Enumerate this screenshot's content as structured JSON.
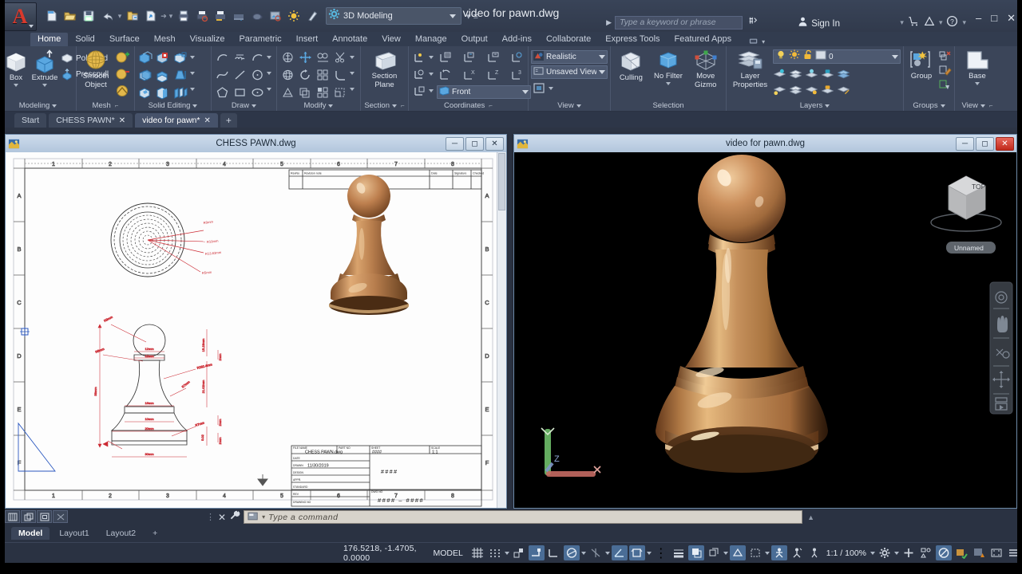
{
  "title_bar": {
    "app_logo": "autocad-a-logo",
    "document_title": "video for pawn.dwg",
    "workspace": "3D Modeling",
    "search_placeholder": "Type a keyword or phrase",
    "sign_in": "Sign In",
    "quick_access": [
      {
        "name": "new",
        "glyph": "new-file-icon"
      },
      {
        "name": "open",
        "glyph": "open-folder-icon"
      },
      {
        "name": "save",
        "glyph": "save-disk-icon"
      },
      {
        "name": "undo",
        "glyph": "undo-arrow-icon"
      },
      {
        "name": "redo",
        "glyph": "redo-arrow-icon"
      },
      {
        "name": "saveas",
        "glyph": "save-as-icon"
      },
      {
        "name": "export",
        "glyph": "export-icon"
      },
      {
        "name": "plot",
        "glyph": "plot-printer-icon"
      },
      {
        "name": "plotpreview",
        "glyph": "plot-preview-icon"
      },
      {
        "name": "batchplot",
        "glyph": "batch-plot-icon"
      },
      {
        "name": "render",
        "glyph": "render-teapot-icon"
      },
      {
        "name": "publish",
        "glyph": "publish-icon"
      },
      {
        "name": "sun",
        "glyph": "sun-properties-icon"
      },
      {
        "name": "properties",
        "glyph": "properties-icon"
      }
    ],
    "window_buttons": [
      "minimize",
      "maximize",
      "close"
    ]
  },
  "ribbon": {
    "tabs": [
      {
        "label": "Home",
        "active": true
      },
      {
        "label": "Solid",
        "active": false
      },
      {
        "label": "Surface",
        "active": false
      },
      {
        "label": "Mesh",
        "active": false
      },
      {
        "label": "Visualize",
        "active": false
      },
      {
        "label": "Parametric",
        "active": false
      },
      {
        "label": "Insert",
        "active": false
      },
      {
        "label": "Annotate",
        "active": false
      },
      {
        "label": "View",
        "active": false
      },
      {
        "label": "Manage",
        "active": false
      },
      {
        "label": "Output",
        "active": false
      },
      {
        "label": "Add-ins",
        "active": false
      },
      {
        "label": "Collaborate",
        "active": false
      },
      {
        "label": "Express Tools",
        "active": false
      },
      {
        "label": "Featured Apps",
        "active": false
      }
    ],
    "panels": [
      {
        "name": "Modeling",
        "big_buttons": [
          {
            "label": "Box",
            "icon": "box-solid-icon",
            "dropdown": true
          },
          {
            "label": "Extrude",
            "icon": "extrude-icon",
            "dropdown": true
          }
        ],
        "small_buttons": [
          {
            "label": "Polysolid",
            "icon": "polysolid-icon"
          },
          {
            "label": "Presspull",
            "icon": "presspull-icon"
          }
        ]
      },
      {
        "name": "Mesh",
        "big_buttons": [
          {
            "label_line1": "Smooth",
            "label_line2": "Object",
            "icon": "smooth-object-sphere-icon"
          }
        ],
        "icons": [
          "mesh-refine-icon",
          "mesh-smooth-less-icon",
          "mesh-crease-icon"
        ],
        "dialog_launcher": true
      },
      {
        "name": "Solid Editing",
        "icons": [
          "solid-union-icon",
          "solid-subtract-icon",
          "solid-3dmove-icon",
          "solid-intersect-icon",
          "solid-slice-icon",
          "solid-taper-face-icon",
          "solid-imprint-icon",
          "solid-shell-icon",
          "solid-separate-icon"
        ]
      },
      {
        "name": "Draw",
        "icons": [
          "arc-icon",
          "revcloud-icon",
          "arc3point-icon",
          "spline-icon",
          "line-icon",
          "circle-icon",
          "polygon-icon",
          "rectangle-icon",
          "ellipse-icon"
        ]
      },
      {
        "name": "Modify",
        "icons": [
          "3d-align-icon",
          "move-icon",
          "3d-mirror-icon",
          "trim-icon",
          "3d-rotate-icon",
          "rotate-icon",
          "3d-array-icon",
          "fillet-icon",
          "3d-scale-icon",
          "scale-icon",
          "offset-icon",
          "array-icon"
        ]
      },
      {
        "name": "Section",
        "big_buttons": [
          {
            "label_line1": "Section",
            "label_line2": "Plane",
            "icon": "section-plane-icon"
          }
        ],
        "dialog_launcher": true
      },
      {
        "name": "Coordinates",
        "icons": [
          "ucs-origin-icon",
          "ucs-named-icon",
          "ucs-face-icon",
          "ucs-view-icon",
          "ucs-object-icon",
          "ucs-world-icon",
          "ucs-previous-icon",
          "ucs-x-icon",
          "ucs-z-icon",
          "ucs-3point-icon",
          "ucs-display-icon"
        ],
        "combo": {
          "value": "Front",
          "icon": "ucs-front-icon"
        },
        "dialog_launcher": true
      },
      {
        "name": "View",
        "combos": [
          {
            "value": "Realistic",
            "icon": "visual-style-icon"
          },
          {
            "value": "Unsaved View",
            "icon": "named-view-icon"
          }
        ],
        "icons": [
          "viewport-config-icon"
        ]
      },
      {
        "name": "Selection",
        "big_buttons": [
          {
            "label": "Culling",
            "icon": "culling-cube-icon"
          },
          {
            "label": "No Filter",
            "icon": "no-filter-cube-icon",
            "dropdown": true
          },
          {
            "label_line1": "Move",
            "label_line2": "Gizmo",
            "icon": "move-gizmo-icon",
            "dropdown": true
          }
        ]
      },
      {
        "name": "Layers",
        "big_buttons": [
          {
            "label_line1": "Layer",
            "label_line2": "Properties",
            "icon": "layer-properties-icon"
          }
        ],
        "layer_combo": {
          "value": "0",
          "state_icons": [
            "layer-on-bulb-icon",
            "layer-thaw-sun-icon",
            "layer-unlock-icon",
            "layer-color-swatch"
          ]
        },
        "icons_row1": [
          "layer-isolate-icon",
          "layer-unisolate-icon",
          "layer-freeze-icon",
          "layer-lock-icon",
          "layer-make-current-icon"
        ],
        "icons_row2": [
          "layer-off-icon",
          "layer-turn-all-on-icon",
          "layer-thaw-all-icon",
          "layer-unlock-all-icon",
          "layer-match-icon"
        ]
      },
      {
        "name": "Groups",
        "big_buttons": [
          {
            "label": "Group",
            "icon": "group-icon"
          }
        ],
        "icons": [
          "ungroup-icon",
          "group-edit-icon",
          "group-selection-icon"
        ]
      },
      {
        "name": "View",
        "big_buttons": [
          {
            "label": "Base",
            "icon": "base-view-icon",
            "dropdown": true
          }
        ],
        "dialog_launcher": true
      }
    ]
  },
  "file_tabs": [
    {
      "label": "Start",
      "active": false,
      "closable": false
    },
    {
      "label": "CHESS PAWN*",
      "active": false,
      "closable": true
    },
    {
      "label": "video for pawn*",
      "active": true,
      "closable": true
    },
    {
      "label": "+",
      "active": false,
      "closable": false
    }
  ],
  "windows": {
    "left": {
      "title": "CHESS PAWN.dwg",
      "icon": "dwg-file-icon",
      "buttons": [
        "minimize",
        "restore",
        "close"
      ],
      "drawing": {
        "ruler_top": [
          "1",
          "2",
          "3",
          "4",
          "5",
          "6",
          "7",
          "8"
        ],
        "ruler_left": [
          "A",
          "B",
          "C",
          "D",
          "E",
          "F"
        ],
        "ruler_right": [
          "A",
          "B",
          "C",
          "D",
          "E",
          "F"
        ],
        "ruler_bottom": [
          "1",
          "2",
          "3",
          "4",
          "5",
          "6",
          "7",
          "8"
        ],
        "revision_table_headers": [
          "RevNo",
          "Revision note",
          "Date",
          "Signature",
          "Checked"
        ],
        "title_block": {
          "file_name_label": "FILE NAME",
          "file_name": "CHESS PAWN.dwg",
          "part_no_label": "PART NO",
          "sheet_label": "SHEET",
          "sheet": "####",
          "scale_label": "SCALE",
          "scale": "1:1",
          "rows": [
            {
              "label": "DATE",
              "value": ""
            },
            {
              "label": "DRAWN",
              "value": "11/30/2019"
            },
            {
              "label": "DESIGN",
              "value": ""
            },
            {
              "label": "APPR.",
              "value": ""
            },
            {
              "label": "STANDARD",
              "value": ""
            },
            {
              "label": "REV",
              "value": ""
            },
            {
              "label": "DRAWING NO",
              "value": ""
            }
          ],
          "center_code": "####",
          "dwg_no_label": "DWG NO",
          "dwg_no": "#### - ####"
        },
        "top_view_dimensions": [
          "R9mm",
          "R10mm",
          "R13.83mm",
          "R5mm"
        ],
        "front_view_dimensions": [
          "12mm",
          "12mm",
          "16mm",
          "10mm",
          "20mm",
          "10mm",
          "R282.4mm",
          "R7mm",
          "R6mm",
          "58mm",
          "15.23mm",
          "21.02mm",
          "2mm",
          "3mm",
          "5.02",
          "2mm",
          "2mm"
        ]
      }
    },
    "right": {
      "title": "video for pawn.dwg",
      "icon": "dwg-file-icon",
      "buttons": [
        "minimize",
        "restore",
        "close"
      ],
      "viewcube_label": "TOP",
      "view_name": "Unnamed",
      "ucs_axes": [
        "X",
        "Y",
        "Z"
      ],
      "nav_bar_icons": [
        "steering-wheel-icon",
        "pan-hand-icon",
        "zoom-extents-icon",
        "orbit-icon",
        "show-motion-icon"
      ],
      "model_color": "#c08452"
    }
  },
  "command_line": {
    "viewport_controls": [
      "viewport-restore-icon",
      "viewport-tile-icon",
      "viewport-maximize-icon",
      "viewport-close-icon"
    ],
    "close_icon": "close-icon",
    "customize_icon": "wrench-icon",
    "prompt_icon": "command-prompt-icon",
    "placeholder": "Type a command"
  },
  "layout_tabs": [
    {
      "label": "Model",
      "active": true
    },
    {
      "label": "Layout1",
      "active": false
    },
    {
      "label": "Layout2",
      "active": false
    },
    {
      "label": "+",
      "active": false
    }
  ],
  "status_bar": {
    "coordinates": "176.5218, -1.4705, 0.0000",
    "space": "MODEL",
    "scale": "1:1 / 100%",
    "toggles": [
      {
        "name": "grid-display",
        "on": false
      },
      {
        "name": "snap-mode",
        "on": false
      },
      {
        "name": "infer-constraints",
        "on": false
      },
      {
        "name": "ortho-mode",
        "on": true
      },
      {
        "name": "polar-tracking",
        "on": false
      },
      {
        "name": "isometric-drafting",
        "on": true
      },
      {
        "name": "object-snap-tracking",
        "on": false
      },
      {
        "name": "object-snap",
        "on": true
      },
      {
        "name": "dynamic-ucs",
        "on": true
      },
      {
        "name": "dynamic-input",
        "on": false
      },
      {
        "name": "lineweight",
        "on": false
      },
      {
        "name": "transparency",
        "on": true
      },
      {
        "name": "selection-cycling",
        "on": true
      },
      {
        "name": "3d-object-snap",
        "on": false
      },
      {
        "name": "annotation-visibility",
        "on": true
      },
      {
        "name": "autoscale",
        "on": false
      },
      {
        "name": "annotation-scale",
        "on": false
      },
      {
        "name": "workspace-switching",
        "on": false
      },
      {
        "name": "annotation-monitor",
        "on": false
      },
      {
        "name": "units",
        "on": false
      },
      {
        "name": "quick-properties",
        "on": false
      },
      {
        "name": "isolate-objects",
        "on": true
      },
      {
        "name": "graphics-performance",
        "on": false
      },
      {
        "name": "clean-screen",
        "on": false
      },
      {
        "name": "customization",
        "on": false
      }
    ]
  },
  "colors": {
    "ribbon_bg": "#3b4559",
    "titlebar_bg": "#394458",
    "accent_blue": "#4a6d96",
    "logo_red": "#d9392c",
    "model_brown": "#c08452",
    "dimension_red": "#d4323a",
    "paper_white": "#ffffff"
  }
}
